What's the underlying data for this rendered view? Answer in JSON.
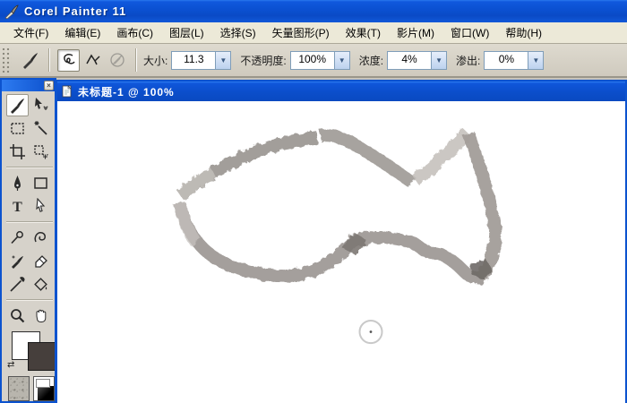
{
  "window": {
    "title": "Corel Painter 11",
    "app_icon": "paintbrush-icon"
  },
  "menubar": {
    "items": [
      "文件(F)",
      "编辑(E)",
      "画布(C)",
      "图层(L)",
      "选择(S)",
      "矢量图形(P)",
      "效果(T)",
      "影片(M)",
      "窗口(W)",
      "帮助(H)"
    ]
  },
  "property_bar": {
    "brush_indicator_icon": "brush-icon",
    "stroke_buttons": [
      {
        "name": "freehand-strokes",
        "icon": "freehand-curl-icon",
        "pressed": true
      },
      {
        "name": "straight-line-strokes",
        "icon": "zigzag-line-icon",
        "pressed": false
      },
      {
        "name": "clone-color",
        "icon": "crossed-brush-icon",
        "disabled": true
      }
    ],
    "size": {
      "label": "大小:",
      "value": "11.3"
    },
    "opacity": {
      "label": "不透明度:",
      "value": "100%"
    },
    "resat": {
      "label": "浓度:",
      "value": "4%"
    },
    "bleed": {
      "label": "渗出:",
      "value": "0%"
    }
  },
  "document": {
    "title": "未标题-1 @ 100%",
    "zoom": "100%",
    "artwork": "textured chalk-stroke outline sketch of a fish facing right, gray strokes on white canvas, round brush ghost cursor below the drawing",
    "stroke_color": "#a39e9a"
  },
  "toolbox": {
    "close_label": "×",
    "tools": [
      "brush",
      "layer-adjuster",
      "rectangular-selection",
      "magic-wand",
      "crop",
      "selection-adjuster",
      "pen",
      "rectangular-shape",
      "text",
      "shape-selection",
      "scissors",
      "rotate-page",
      "cloner",
      "eraser",
      "dropper",
      "paint-bucket",
      "magnifier",
      "grabber"
    ],
    "selected_tool": "brush",
    "main_color": "#ffffff",
    "additional_color": "#463f3c"
  },
  "colors": {
    "titlebar_blue": "#0b51d2",
    "menubar_bg": "#ece9d8",
    "toolbar_bg": "#d4d0c8",
    "canvas_bg": "#ffffff"
  }
}
